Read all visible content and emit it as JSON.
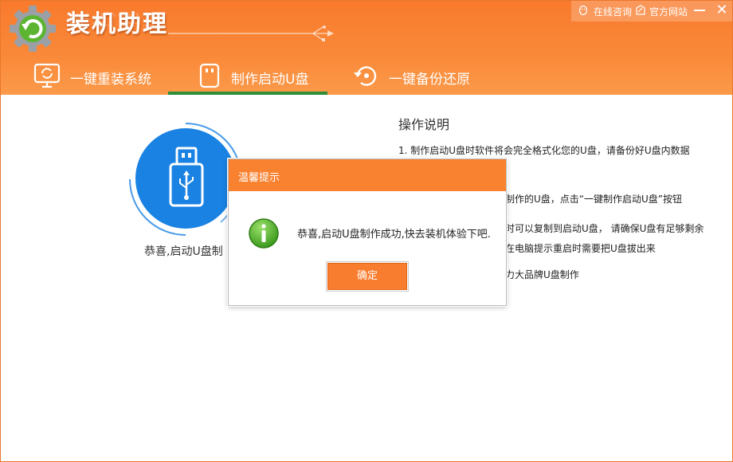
{
  "app": {
    "title": "装机助理",
    "title_reflection": "装机助理"
  },
  "top_links": {
    "online_consult": "在线咨询",
    "official_site": "官方网站"
  },
  "tabs": [
    {
      "label": "一键重装系统",
      "icon": "monitor-refresh-icon"
    },
    {
      "label": "制作启动U盘",
      "icon": "usb-drive-icon",
      "active": true
    },
    {
      "label": "一键备份还原",
      "icon": "backup-restore-icon"
    }
  ],
  "main": {
    "success_text": "恭喜,启动U盘制",
    "instructions_title": "操作说明",
    "instructions": [
      "1.   制作启动U盘时软件将会完全格式化您的U盘，请备份好U盘内数据",
      "制作的U盘，点击“一键制作启动U盘”按钮",
      "时可以复制到启动U盘， 请确保U盘有足够剩余",
      "在电脑提示重启时需要把U盘拔出来",
      "力大品牌U盘制作"
    ]
  },
  "dialog": {
    "title": "温馨提示",
    "message": "恭喜,启动U盘制作成功,快去装机体验下吧.",
    "ok_label": "确定"
  },
  "colors": {
    "header_orange": "#f97a2d",
    "active_tab_bar": "#2f8d3a",
    "usb_blue": "#1a82e2",
    "dialog_orange": "#f98231"
  }
}
